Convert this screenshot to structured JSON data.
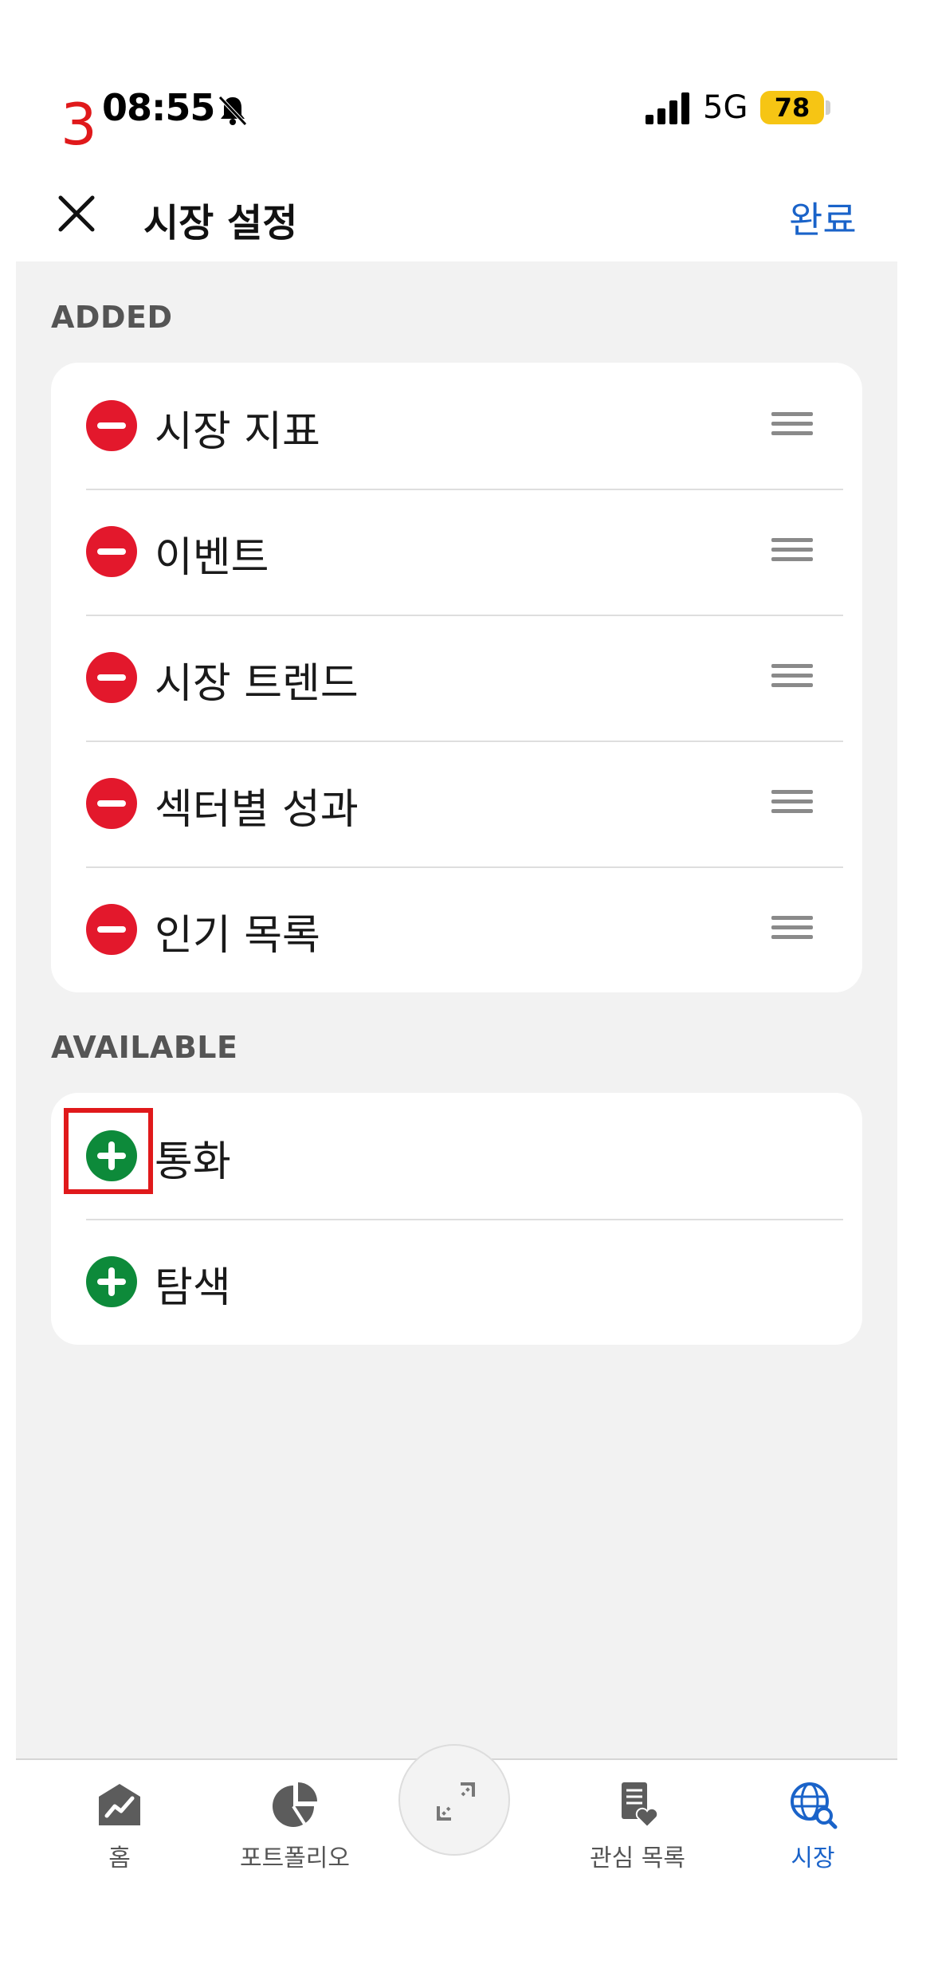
{
  "step_marker": "3",
  "status_bar": {
    "time": "08:55",
    "network": "5G",
    "battery": "78"
  },
  "header": {
    "title": "시장 설정",
    "done_label": "완료"
  },
  "sections": {
    "added_label": "ADDED",
    "added_items": [
      {
        "label": "시장 지표"
      },
      {
        "label": "이벤트"
      },
      {
        "label": "시장 트렌드"
      },
      {
        "label": "섹터별 성과"
      },
      {
        "label": "인기 목록"
      }
    ],
    "available_label": "AVAILABLE",
    "available_items": [
      {
        "label": "통화"
      },
      {
        "label": "탐색"
      }
    ]
  },
  "tabbar": {
    "items": [
      {
        "label": "홈",
        "icon": "home-chart-icon"
      },
      {
        "label": "포트폴리오",
        "icon": "pie-chart-icon"
      },
      {
        "label": "관심 목록",
        "icon": "watchlist-icon"
      },
      {
        "label": "시장",
        "icon": "globe-search-icon",
        "active": true
      }
    ],
    "center_icon": "expand-arrows-icon"
  },
  "colors": {
    "accent": "#1a63c9",
    "remove": "#e3182c",
    "add": "#0d8a3a",
    "highlight": "#e0191b",
    "battery": "#f6c514"
  }
}
